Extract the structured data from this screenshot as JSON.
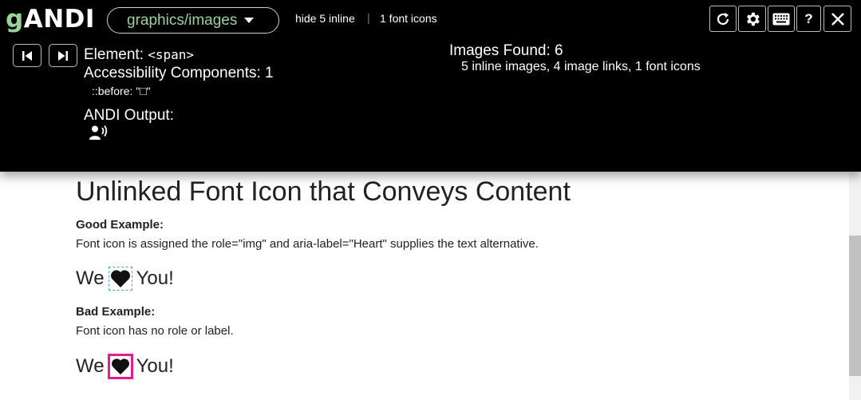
{
  "andi": {
    "logo_prefix": "g",
    "logo_name": "ANDI",
    "module": "graphics/images",
    "hide_inline": "hide 5 inline",
    "font_icons_link": "1 font icons",
    "controls": [
      {
        "name": "refresh",
        "icon": "refresh-icon"
      },
      {
        "name": "settings",
        "icon": "gear-icon"
      },
      {
        "name": "keyboard",
        "icon": "keyboard-icon"
      },
      {
        "name": "help",
        "label": "?"
      },
      {
        "name": "close",
        "icon": "close-icon"
      }
    ],
    "element_label": "Element:",
    "element_value": "<span>",
    "components_label": "Accessibility Components:",
    "components_count": "1",
    "before_value": "::before: \"□\"",
    "output_label": "ANDI Output:",
    "output_icon": "speaker-icon",
    "found_title": "Images Found: 6",
    "found_detail": "5 inline images, 4 image links, 1 font icons"
  },
  "page": {
    "heading": "Unlinked Font Icon that Conveys Content",
    "good": {
      "label": "Good Example:",
      "description": "Font icon is assigned the role=\"img\" and aria-label=\"Heart\" supplies the text alternative.",
      "before": "We",
      "after": "You!",
      "icon": "heart-icon"
    },
    "bad": {
      "label": "Bad Example:",
      "description": "Font icon has no role or label.",
      "before": "We",
      "after": "You!",
      "icon": "heart-icon"
    }
  },
  "colors": {
    "andi_bg": "#000000",
    "logo_green": "#9ad39a",
    "highlight_pink": "#e31d8e",
    "focus_dashed": "#4aa5b5"
  }
}
